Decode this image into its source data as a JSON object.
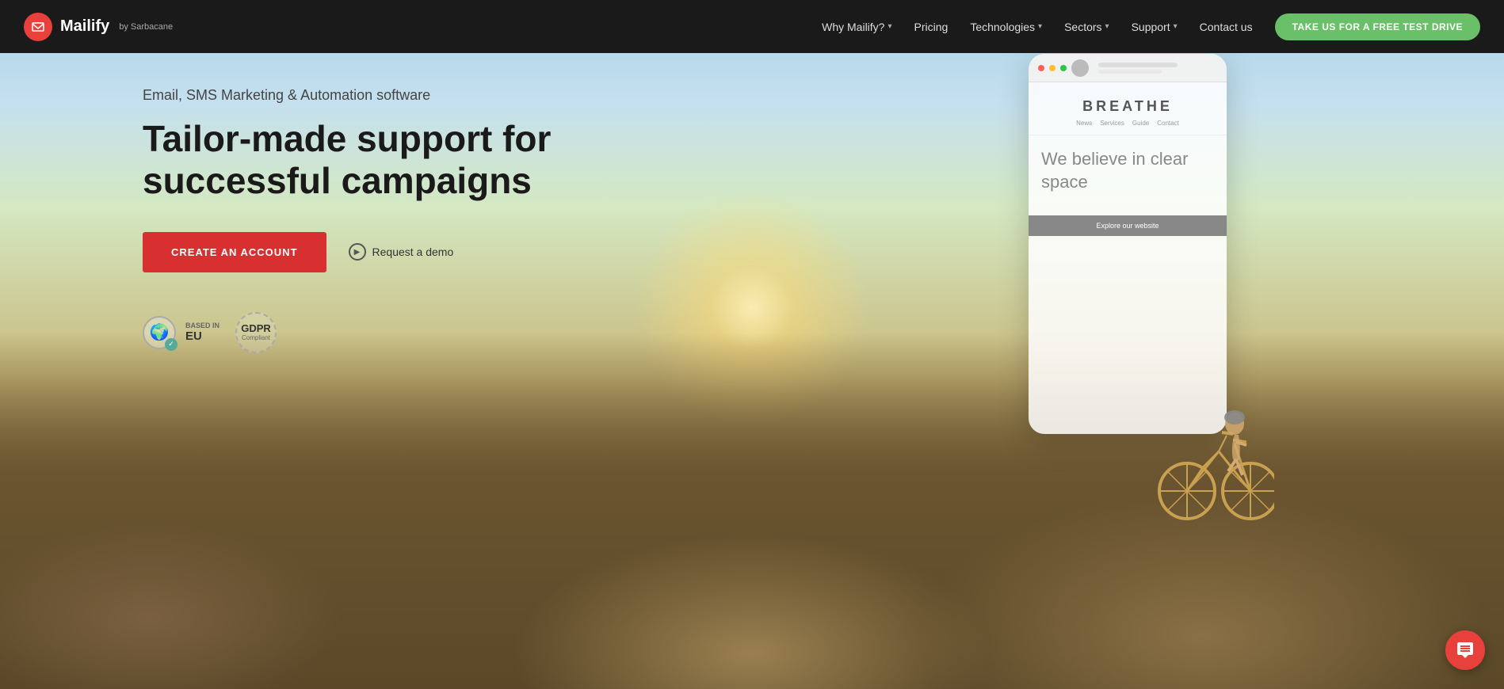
{
  "brand": {
    "name": "Mailify",
    "sub": "by Sarbacane"
  },
  "nav": {
    "items": [
      {
        "label": "Why Mailify?",
        "hasDropdown": true
      },
      {
        "label": "Pricing",
        "hasDropdown": false
      },
      {
        "label": "Technologies",
        "hasDropdown": true
      },
      {
        "label": "Sectors",
        "hasDropdown": true
      },
      {
        "label": "Support",
        "hasDropdown": true
      },
      {
        "label": "Contact us",
        "hasDropdown": false
      }
    ],
    "cta": "TAKE US FOR A FREE TEST DRIVE"
  },
  "hero": {
    "subtitle": "Email, SMS Marketing & Automation software",
    "title": "Tailor-made support for successful campaigns",
    "create_btn": "CREATE AN ACCOUNT",
    "demo_label": "Request a demo",
    "badge_eu": "BASED IN\nEU",
    "badge_gdpr": "GDPR\nCompliant"
  },
  "phone": {
    "brand_name": "BREATHE",
    "nav_items": [
      "News",
      "Services",
      "Guide",
      "Contact"
    ],
    "big_text": "We believe in clear space",
    "explore_btn": "Explore our website"
  }
}
